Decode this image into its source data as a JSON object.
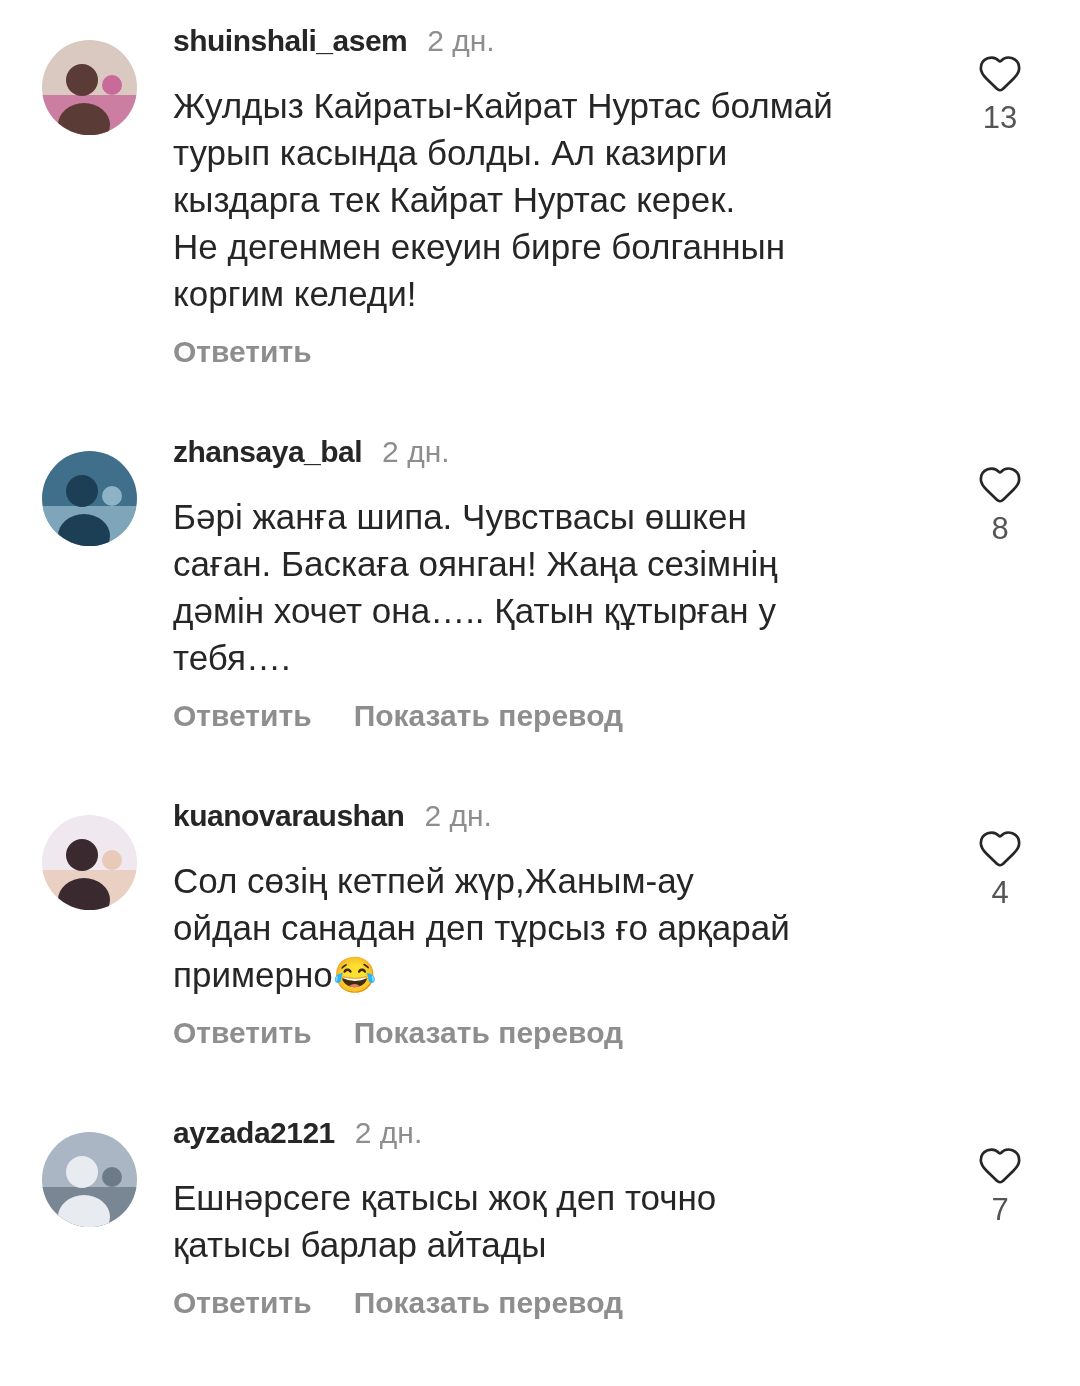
{
  "comments": [
    {
      "username": "shuinshali_asem",
      "time": "2 дн.",
      "text": "Жулдыз Кайраты-Кайрат Нуртас болмай\nтурып касында болды. Ал казирги\nкыздарга тек Кайрат Нуртас керек.\nНе дегенмен екеуин бирге болганнын\nкоргим келеди!",
      "likes": "13",
      "liked": false,
      "actions": [
        "Ответить"
      ]
    },
    {
      "username": "zhansaya_bal",
      "time": "2 дн.",
      "text": "Бәрі жанға шипа. Чувствасы өшкен\nсаған. Баскаға оянган! Жаңа сезімнің\nдәмін хочет она….. Қатын құтырған у\nтебя….",
      "likes": "8",
      "liked": false,
      "actions": [
        "Ответить",
        "Показать перевод"
      ]
    },
    {
      "username": "kuanovaraushan",
      "time": "2 дн.",
      "text": "Сол сөзің кетпей жүр,Жаным-ау\nойдан санадан деп тұрсыз ғо арқарай\nпримерно😂",
      "likes": "4",
      "liked": false,
      "actions": [
        "Ответить",
        "Показать перевод"
      ]
    },
    {
      "username": "ayzada2121",
      "time": "2 дн.",
      "text": "Ешнәрсеге қатысы жоқ деп точно\nқатысы барлар айтады",
      "likes": "7",
      "liked": false,
      "actions": [
        "Ответить",
        "Показать перевод"
      ]
    }
  ]
}
